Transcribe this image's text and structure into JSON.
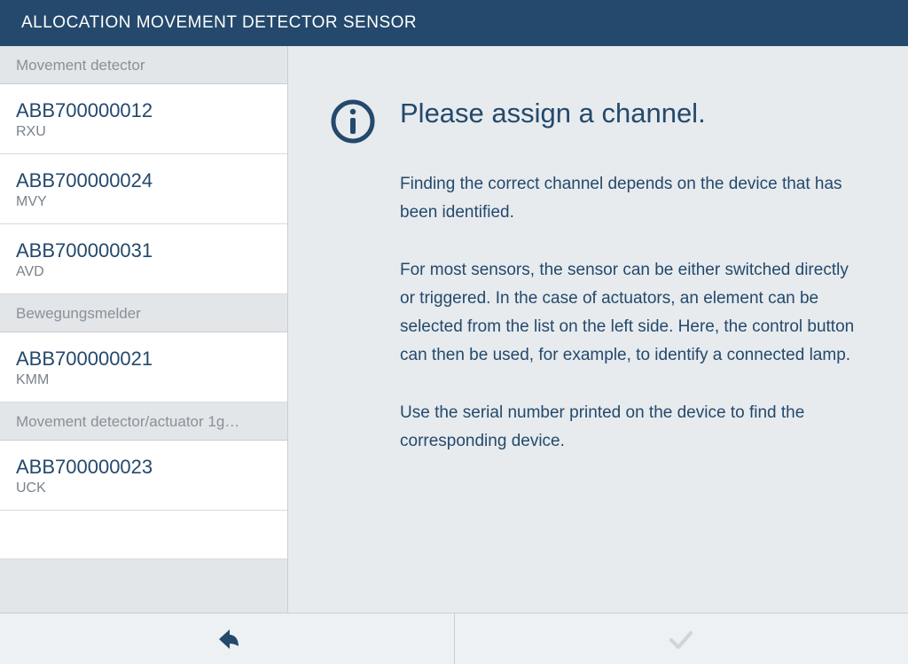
{
  "titleBar": {
    "title": "ALLOCATION MOVEMENT DETECTOR SENSOR"
  },
  "sidebar": {
    "sections": [
      {
        "header": "Movement detector",
        "items": [
          {
            "serial": "ABB700000012",
            "code": "RXU"
          },
          {
            "serial": "ABB700000024",
            "code": "MVY"
          },
          {
            "serial": "ABB700000031",
            "code": "AVD"
          }
        ]
      },
      {
        "header": "Bewegungsmelder",
        "items": [
          {
            "serial": "ABB700000021",
            "code": "KMM"
          }
        ]
      },
      {
        "header": "Movement detector/actuator 1g…",
        "items": [
          {
            "serial": "ABB700000023",
            "code": "UCK"
          }
        ]
      }
    ]
  },
  "main": {
    "heading": "Please assign a channel.",
    "paragraphs": [
      "Finding the correct channel depends on the device that has been identified.",
      "For most sensors, the sensor can be either switched directly or triggered. In the case of actuators, an element can be selected from the list on the left side. Here, the control button can then be used, for example, to identify a connected lamp.",
      "Use the serial number printed on the device to find the corresponding device."
    ]
  },
  "colors": {
    "titlebar_bg": "#24496c",
    "primary_text": "#24496c",
    "muted_text": "#8a9099",
    "disabled_icon": "#b6bcc2"
  }
}
